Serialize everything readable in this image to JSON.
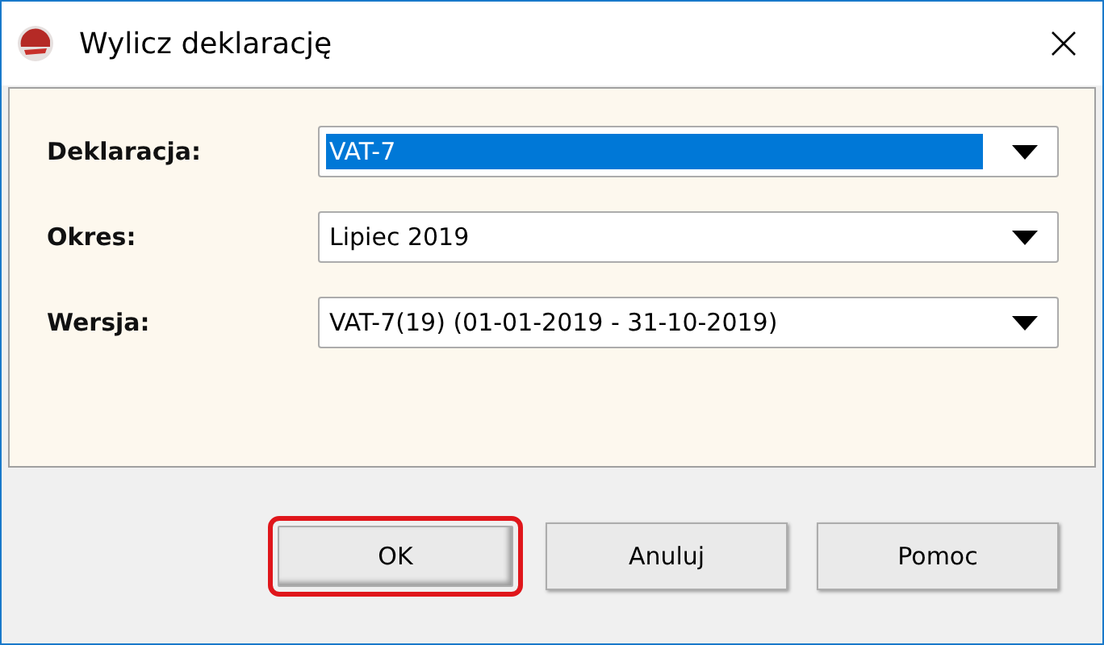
{
  "window": {
    "title": "Wylicz deklarację"
  },
  "fields": [
    {
      "label": "Deklaracja:",
      "value": "VAT-7",
      "text_selected": true
    },
    {
      "label": "Okres:",
      "value": "Lipiec 2019",
      "text_selected": false
    },
    {
      "label": "Wersja:",
      "value": "VAT-7(19) (01-01-2019 - 31-10-2019)",
      "text_selected": false
    }
  ],
  "buttons": [
    {
      "label": "OK",
      "highlighted": true
    },
    {
      "label": "Anuluj",
      "highlighted": false
    },
    {
      "label": "Pomoc",
      "highlighted": false
    }
  ]
}
